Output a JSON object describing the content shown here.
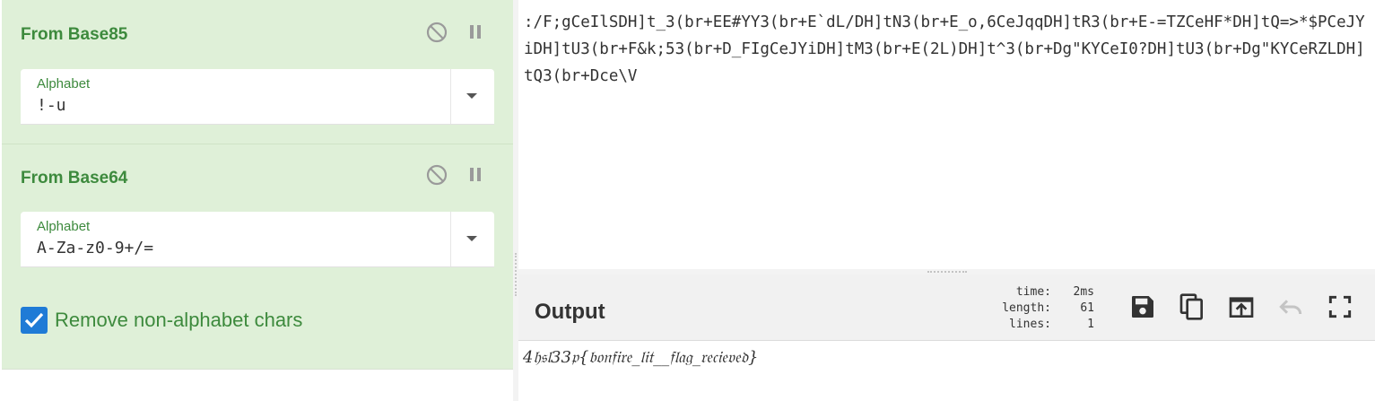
{
  "recipe": {
    "operations": [
      {
        "title": "From Base85",
        "field_label": "Alphabet",
        "field_value": "!-u"
      },
      {
        "title": "From Base64",
        "field_label": "Alphabet",
        "field_value": "A-Za-z0-9+/=",
        "checkbox_label": "Remove non-alphabet chars",
        "checkbox_checked": true
      }
    ]
  },
  "input": {
    "text": ":/F;gCeIlSDH]t_3(br+EE#YY3(br+E`dL/DH]tN3(br+E_o,6CeJqqDH]tR3(br+E-=TZCeHF*DH]tQ=>*$PCeJYiDH]tU3(br+F&k;53(br+D_FIgCeJYiDH]tM3(br+E(2L)DH]t^3(br+Dg\"KYCeI0?DH]tU3(br+Dg\"KYCeRZLDH]tQ3(br+Dce\\V"
  },
  "output": {
    "title": "Output",
    "stats": [
      {
        "key": "time:",
        "value": "2ms"
      },
      {
        "key": "length:",
        "value": "61"
      },
      {
        "key": "lines:",
        "value": "1"
      }
    ],
    "text": "4𝔥𝔰𝔩33𝔭{𝔟𝔬𝔫𝔣𝔦𝔯𝔢_𝔩𝔦𝔱__𝔣𝔩𝔞𝔤_𝔯𝔢𝔠𝔦𝔢𝔳𝔢𝔡}"
  },
  "colors": {
    "op_background": "#dff0d8",
    "op_title": "#3d8a3d",
    "checkbox": "#1f7bd6",
    "output_header": "#f1f1f1"
  },
  "icons": [
    "disable-icon",
    "pause-icon",
    "dropdown-caret-icon",
    "check-icon",
    "save-icon",
    "copy-icon",
    "replace-input-icon",
    "undo-icon",
    "maximise-icon"
  ]
}
